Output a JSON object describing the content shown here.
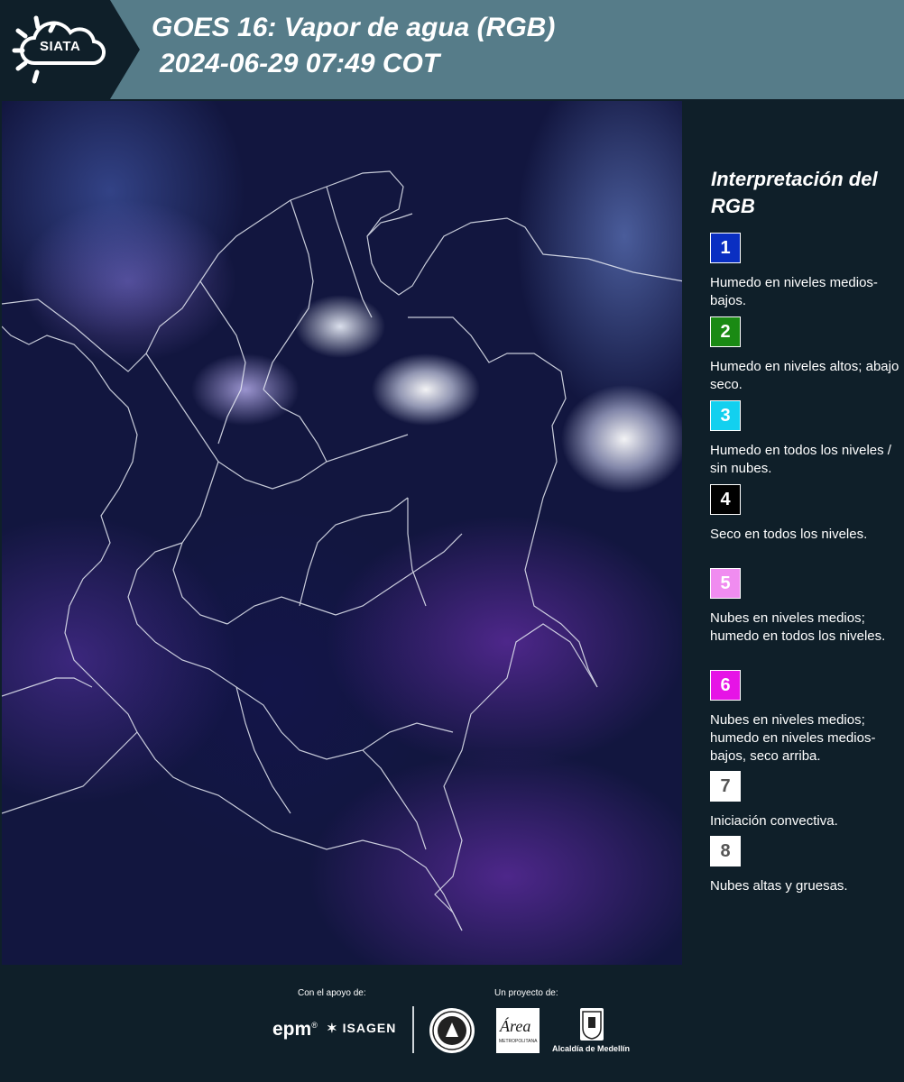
{
  "header": {
    "logo_text": "SIATA",
    "title_line1": "GOES 16: Vapor de agua (RGB)",
    "title_line2": "2024-06-29 07:49 COT"
  },
  "map": {
    "type": "satellite water vapor RGB composite with political boundaries"
  },
  "legend": {
    "title": "Interpretación del RGB",
    "items": [
      {
        "number": "1",
        "color": "#0a2fc2",
        "description": "Humedo en niveles medios-bajos."
      },
      {
        "number": "2",
        "color": "#1a8a14",
        "description": "Humedo en niveles altos; abajo seco."
      },
      {
        "number": "3",
        "color": "#13d0ef",
        "description": "Humedo en todos los niveles / sin nubes."
      },
      {
        "number": "4",
        "color": "#000000",
        "description": "Seco en todos los niveles."
      },
      {
        "number": "5",
        "color": "#f08cf0",
        "description": "Nubes en niveles medios; humedo en todos los niveles."
      },
      {
        "number": "6",
        "color": "#e614e6",
        "description": "Nubes en niveles medios; humedo en niveles medios-bajos, seco arriba."
      },
      {
        "number": "7",
        "color": "#ffffff",
        "description": "Iniciación convectiva."
      },
      {
        "number": "8",
        "color": "#ffffff",
        "description": "Nubes altas y gruesas."
      }
    ]
  },
  "footer": {
    "support_label": "Con el apoyo de:",
    "project_label": "Un proyecto de:",
    "epm": "epm",
    "epm_reg": "®",
    "isagen": "ISAGEN",
    "area_logo": "Área",
    "area_sub": "METROPOLITANA",
    "alcaldia": "Alcaldía de Medellín"
  }
}
